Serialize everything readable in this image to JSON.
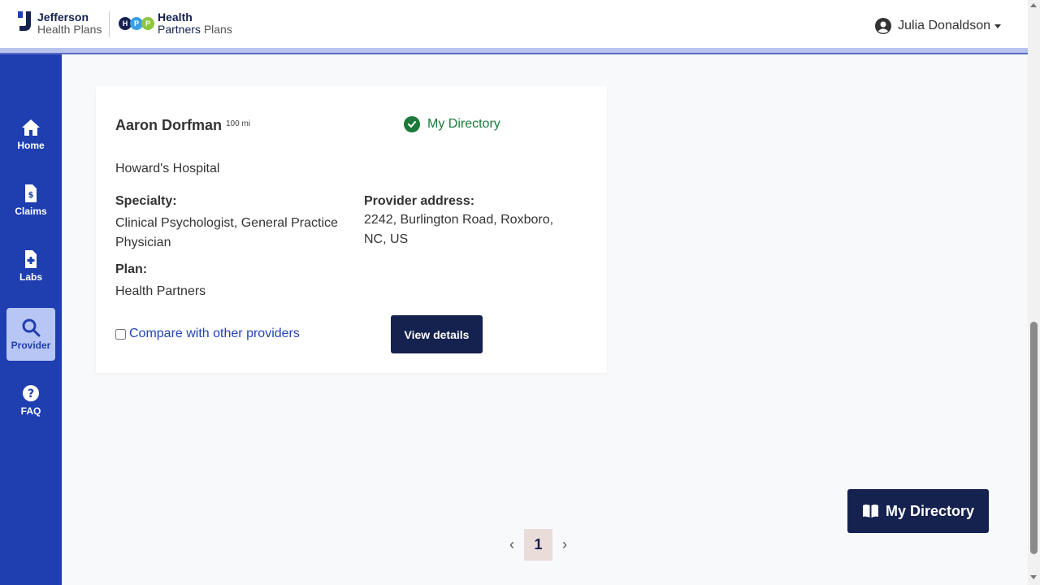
{
  "header": {
    "logo_jefferson_line1": "Jefferson",
    "logo_jefferson_line2": "Health Plans",
    "logo_hpp_line1": "Health",
    "logo_hpp_line2a": "Partners",
    "logo_hpp_line2b": "Plans",
    "hpp_letters": [
      "H",
      "P",
      "P"
    ],
    "user_name": "Julia Donaldson"
  },
  "sidebar": {
    "items": [
      {
        "label": "Home",
        "icon": "home-icon"
      },
      {
        "label": "Claims",
        "icon": "claims-icon"
      },
      {
        "label": "Labs",
        "icon": "labs-icon"
      },
      {
        "label": "Provider",
        "icon": "search-icon",
        "active": true
      },
      {
        "label": "FAQ",
        "icon": "help-icon"
      }
    ]
  },
  "provider_card": {
    "name": "Aaron Dorfman",
    "distance": "100 mi",
    "directory_status": "My Directory",
    "hospital": "Howard's Hospital",
    "specialty_label": "Specialty:",
    "specialty_line1": "Clinical Psychologist, General Practice",
    "specialty_line2": "Physician",
    "address_label": "Provider address:",
    "address_line1": "2242, Burlington Road, Roxboro,",
    "address_line2": "NC, US",
    "plan_label": "Plan:",
    "plan_value": "Health Partners",
    "compare_label": "Compare with other providers",
    "compare_checked": false,
    "view_details_label": "View details"
  },
  "floating_button": {
    "label": "My Directory",
    "icon": "book-open-icon"
  },
  "pagination": {
    "prev": "‹",
    "current": "1",
    "next": "›"
  },
  "colors": {
    "sidebar_bg": "#1f3eb0",
    "primary_dark": "#15214f",
    "success_green": "#1b7a3a",
    "link_blue": "#2444b8"
  }
}
